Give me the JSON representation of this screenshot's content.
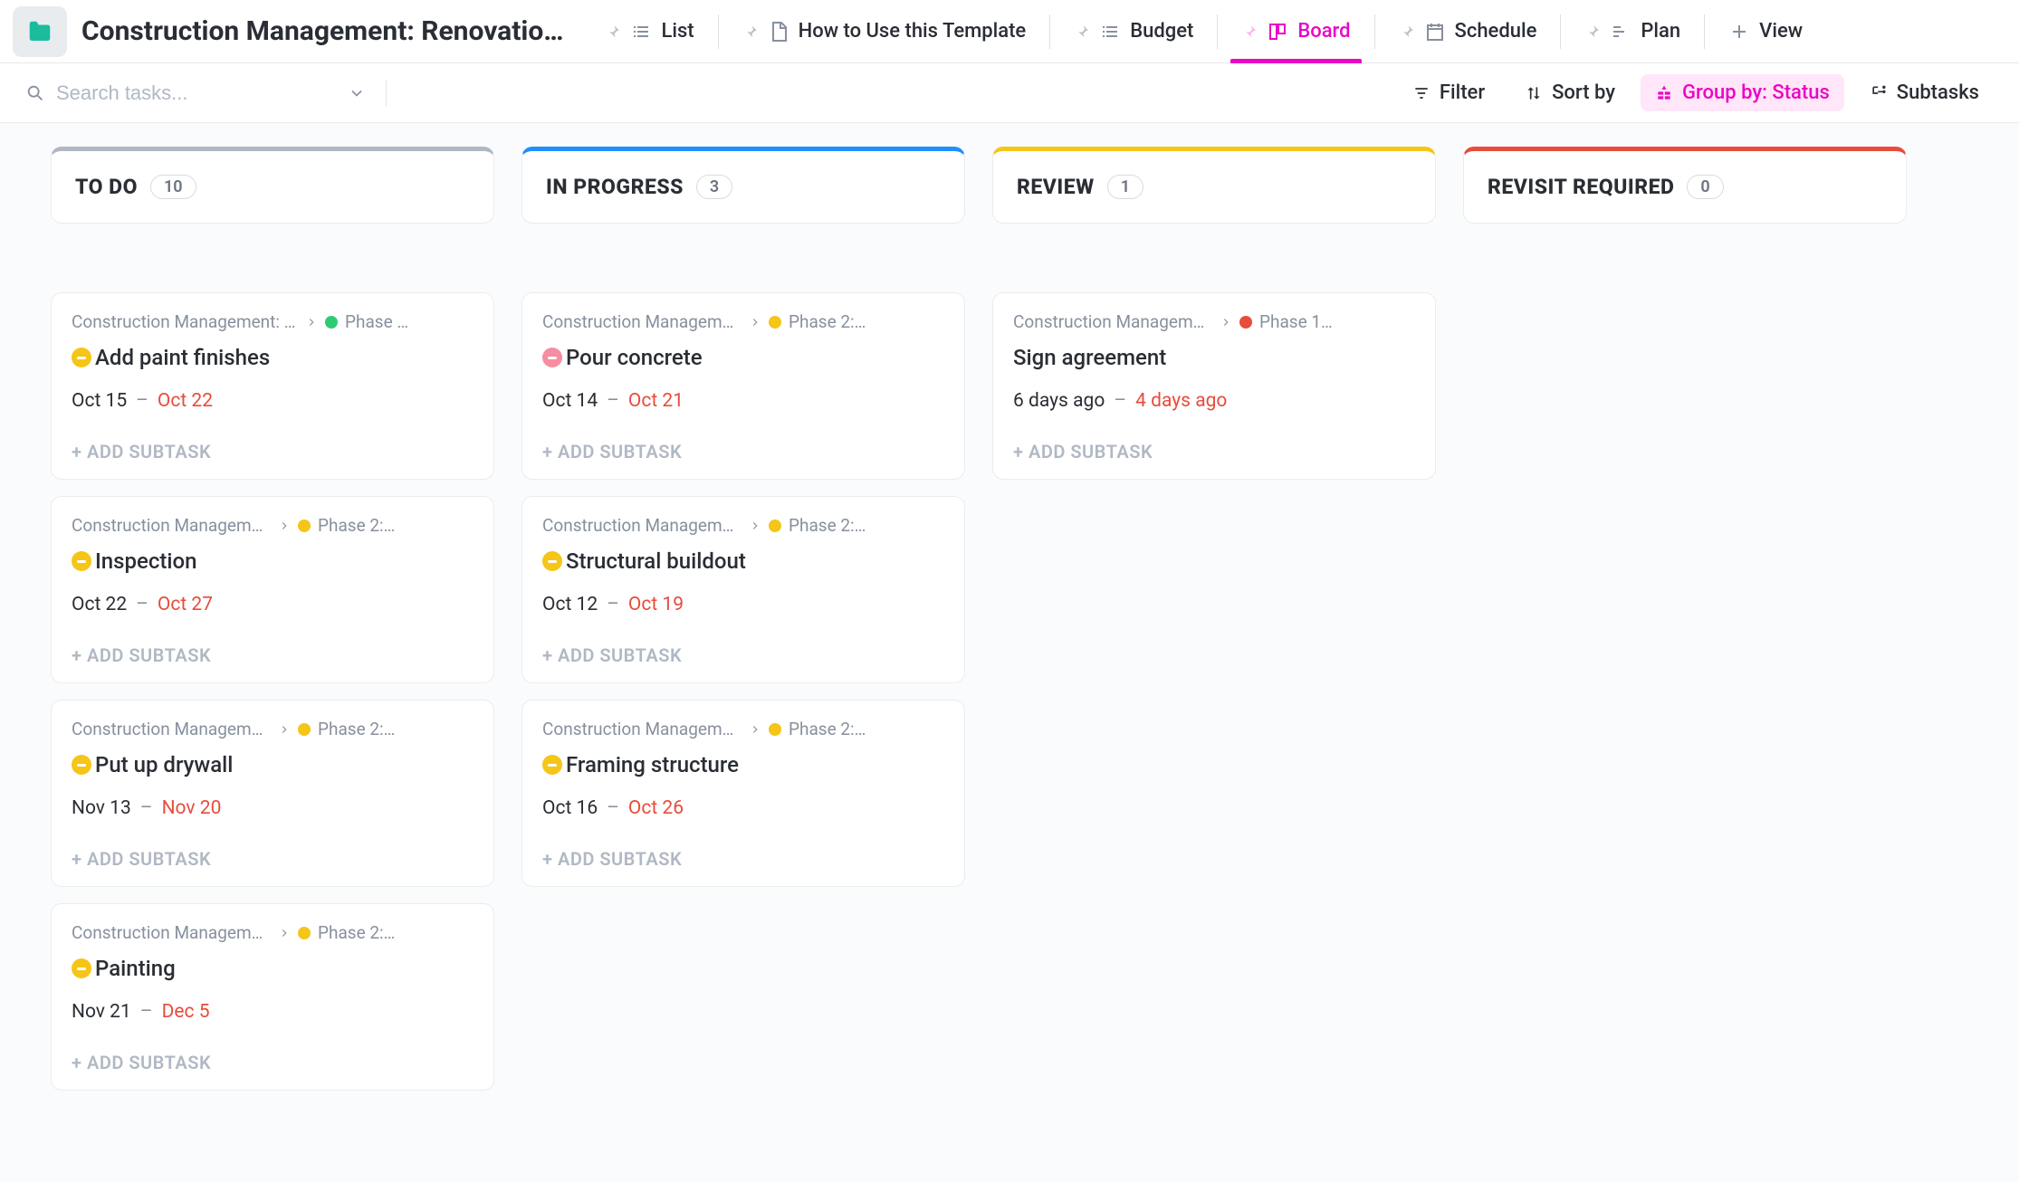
{
  "header": {
    "title": "Construction Management: Renovatio…",
    "tabs": [
      {
        "label": "List",
        "icon": "list"
      },
      {
        "label": "How to Use this Template",
        "icon": "doc"
      },
      {
        "label": "Budget",
        "icon": "list"
      },
      {
        "label": "Board",
        "icon": "board",
        "active": true
      },
      {
        "label": "Schedule",
        "icon": "calendar"
      },
      {
        "label": "Plan",
        "icon": "gantt"
      },
      {
        "label": "View",
        "icon": "plus",
        "plus": true
      }
    ]
  },
  "toolbar": {
    "search_placeholder": "Search tasks...",
    "filter": "Filter",
    "sort": "Sort by",
    "groupby": "Group by: Status",
    "subtasks": "Subtasks"
  },
  "columns": [
    {
      "title": "TO DO",
      "count": 10,
      "bar_color": "#b0b8c4",
      "cards": [
        {
          "project": "Construction Management: Ren…",
          "phase": "Phase …",
          "phase_dot": "green",
          "title": "Add paint finishes",
          "priority": "yellow",
          "start": "Oct 15",
          "due": "Oct 22"
        },
        {
          "project": "Construction Management: R…",
          "phase": "Phase 2:…",
          "phase_dot": "yellow",
          "title": "Inspection",
          "priority": "yellow",
          "start": "Oct 22",
          "due": "Oct 27"
        },
        {
          "project": "Construction Management: R…",
          "phase": "Phase 2:…",
          "phase_dot": "yellow",
          "title": "Put up drywall",
          "priority": "yellow",
          "start": "Nov 13",
          "due": "Nov 20"
        },
        {
          "project": "Construction Management: R…",
          "phase": "Phase 2:…",
          "phase_dot": "yellow",
          "title": "Painting",
          "priority": "yellow",
          "start": "Nov 21",
          "due": "Dec 5"
        }
      ]
    },
    {
      "title": "IN PROGRESS",
      "count": 3,
      "bar_color": "#1e90ff",
      "cards": [
        {
          "project": "Construction Management: R…",
          "phase": "Phase 2:…",
          "phase_dot": "yellow",
          "title": "Pour concrete",
          "priority": "pink",
          "start": "Oct 14",
          "due": "Oct 21"
        },
        {
          "project": "Construction Management: R…",
          "phase": "Phase 2:…",
          "phase_dot": "yellow",
          "title": "Structural buildout",
          "priority": "yellow",
          "start": "Oct 12",
          "due": "Oct 19"
        },
        {
          "project": "Construction Management: R…",
          "phase": "Phase 2:…",
          "phase_dot": "yellow",
          "title": "Framing structure",
          "priority": "yellow",
          "start": "Oct 16",
          "due": "Oct 26"
        }
      ]
    },
    {
      "title": "REVIEW",
      "count": 1,
      "bar_color": "#f5c518",
      "cards": [
        {
          "project": "Construction Management: Ren…",
          "phase": "Phase 1…",
          "phase_dot": "red",
          "title": "Sign agreement",
          "priority": null,
          "start": "6 days ago",
          "due": "4 days ago"
        }
      ]
    },
    {
      "title": "REVISIT REQUIRED",
      "count": 0,
      "bar_color": "#e74c3c",
      "cards": []
    }
  ],
  "labels": {
    "add_subtask": "ADD SUBTASK",
    "date_dash": "–"
  }
}
